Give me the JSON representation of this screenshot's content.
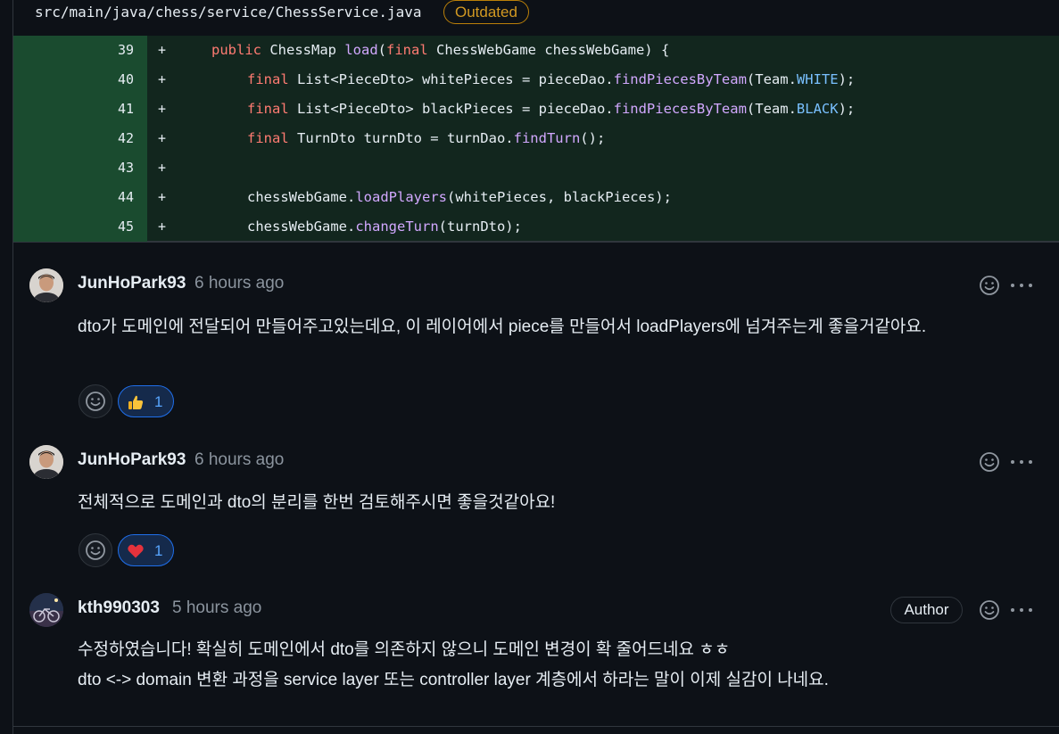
{
  "file": {
    "path": "src/main/java/chess/service/ChessService.java",
    "badge": "Outdated"
  },
  "code": {
    "lines": [
      {
        "num": "39",
        "marker": "+"
      },
      {
        "num": "40",
        "marker": "+"
      },
      {
        "num": "41",
        "marker": "+"
      },
      {
        "num": "42",
        "marker": "+"
      },
      {
        "num": "43",
        "marker": "+"
      },
      {
        "num": "44",
        "marker": "+"
      },
      {
        "num": "45",
        "marker": "+"
      }
    ],
    "tokens": {
      "l39_kw": "public ",
      "l39_a": "ChessMap ",
      "l39_fn": "load",
      "l39_b": "(",
      "l39_kw2": "final ",
      "l39_c": "ChessWebGame chessWebGame) {",
      "l40_kw": "final ",
      "l40_a": "List<PieceDto> whitePieces = pieceDao.",
      "l40_fn": "findPiecesByTeam",
      "l40_b": "(Team.",
      "l40_cn": "WHITE",
      "l40_c": ");",
      "l41_kw": "final ",
      "l41_a": "List<PieceDto> blackPieces = pieceDao.",
      "l41_fn": "findPiecesByTeam",
      "l41_b": "(Team.",
      "l41_cn": "BLACK",
      "l41_c": ");",
      "l42_kw": "final ",
      "l42_a": "TurnDto turnDto = turnDao.",
      "l42_fn": "findTurn",
      "l42_b": "();",
      "l44_a": "chessWebGame.",
      "l44_fn": "loadPlayers",
      "l44_b": "(whitePieces, blackPieces);",
      "l45_a": "chessWebGame.",
      "l45_fn": "changeTurn",
      "l45_b": "(turnDto);"
    }
  },
  "comments": [
    {
      "user": "JunHoPark93",
      "time": "6 hours ago",
      "body": "dto가 도메인에 전달되어 만들어주고있는데요, 이 레이어에서 piece를 만들어서 loadPlayers에 넘겨주는게 좋을거같아요.",
      "reaction_emoji": "thumbs-up",
      "reaction_count": "1"
    },
    {
      "user": "JunHoPark93",
      "time": "6 hours ago",
      "body": "전체적으로 도메인과 dto의 분리를 한번 검토해주시면 좋을것같아요!",
      "reaction_emoji": "heart",
      "reaction_count": "1"
    },
    {
      "user": "kth990303",
      "time": "5 hours ago",
      "badge": "Author",
      "body_line1": "수정하였습니다! 확실히 도메인에서 dto를 의존하지 않으니 도메인 변경이 확 줄어드네요 ㅎㅎ",
      "body_line2": "dto <-> domain 변환 과정을 service layer 또는 controller layer 계층에서 하라는 말이 이제 실감이 나네요."
    }
  ],
  "colors": {
    "added_bg": "#12261e",
    "line_num_bg": "#1a4b2f",
    "keyword": "#ff7b72",
    "function": "#d2a8ff",
    "constant": "#79c0ff",
    "outdated": "#d29922",
    "reaction_border": "#1f6feb"
  }
}
